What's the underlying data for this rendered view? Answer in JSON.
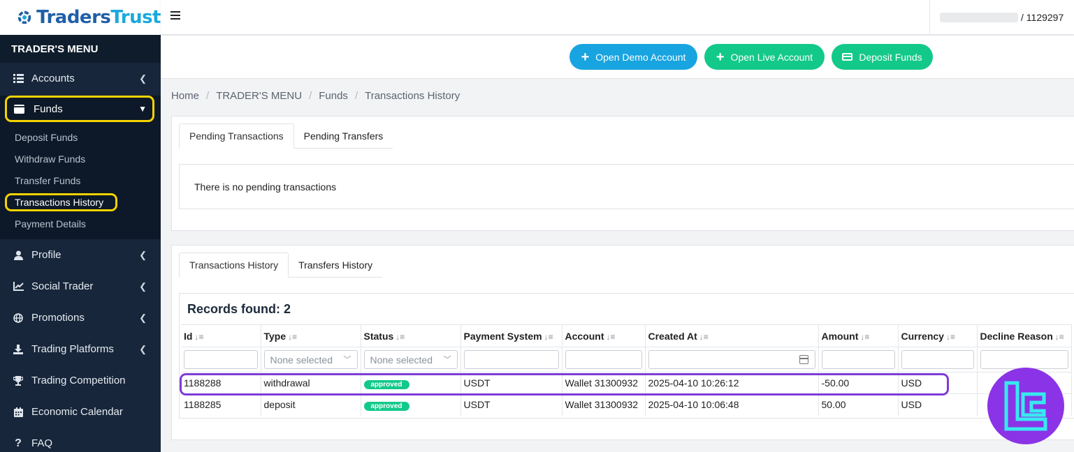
{
  "brand": {
    "name_part1": "Traders",
    "name_part2": "Trust"
  },
  "sidebar": {
    "menu_title": "TRADER'S MENU",
    "accounts": "Accounts",
    "funds": "Funds",
    "funds_sub": {
      "deposit": "Deposit Funds",
      "withdraw": "Withdraw Funds",
      "transfer": "Transfer Funds",
      "history": "Transactions History",
      "payment": "Payment Details"
    },
    "profile": "Profile",
    "social_trader": "Social Trader",
    "promotions": "Promotions",
    "trading_platforms": "Trading Platforms",
    "trading_competition": "Trading Competition",
    "economic_calendar": "Economic Calendar",
    "faq": "FAQ"
  },
  "header": {
    "account_id": "/ 1129297"
  },
  "actions": {
    "demo": "Open Demo Account",
    "live": "Open Live Account",
    "deposit": "Deposit Funds"
  },
  "breadcrumb": {
    "home": "Home",
    "menu": "TRADER'S MENU",
    "funds": "Funds",
    "current": "Transactions History"
  },
  "pending": {
    "tab1": "Pending Transactions",
    "tab2": "Pending Transfers",
    "empty": "There is no pending transactions"
  },
  "history": {
    "tab1": "Transactions History",
    "tab2": "Transfers History",
    "records": "Records found: 2",
    "columns": {
      "id": "Id",
      "type": "Type",
      "status": "Status",
      "payment_system": "Payment System",
      "account": "Account",
      "created_at": "Created At",
      "amount": "Amount",
      "currency": "Currency",
      "decline_reason": "Decline Reason"
    },
    "filter_placeholder": "None selected",
    "rows": [
      {
        "id": "1188288",
        "type": "withdrawal",
        "status": "approved",
        "payment_system": "USDT",
        "account": "Wallet 31300932",
        "created_at": "2025-04-10 10:26:12",
        "amount": "-50.00",
        "currency": "USD",
        "decline_reason": ""
      },
      {
        "id": "1188285",
        "type": "deposit",
        "status": "approved",
        "payment_system": "USDT",
        "account": "Wallet 31300932",
        "created_at": "2025-04-10 10:06:48",
        "amount": "50.00",
        "currency": "USD",
        "decline_reason": ""
      }
    ]
  },
  "colors": {
    "sidebar_bg": "#17263a",
    "highlight_yellow": "#f5d300",
    "highlight_purple": "#7e3bd6",
    "accent_blue": "#18a4e0",
    "accent_green": "#13c98a"
  }
}
